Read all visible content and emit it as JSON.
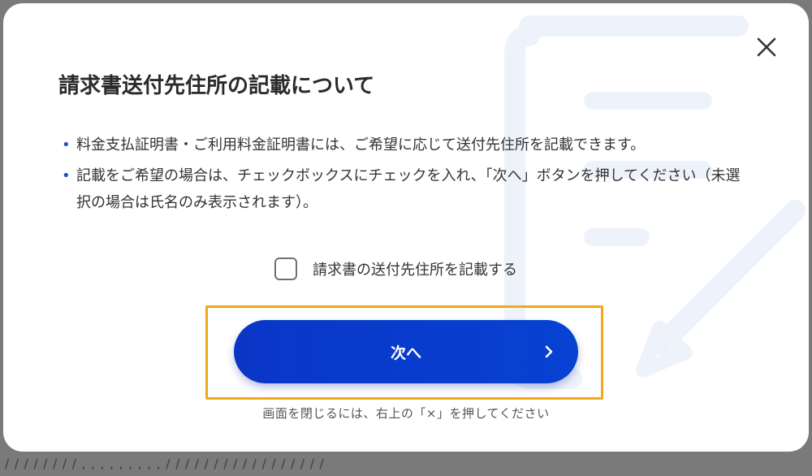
{
  "background": {
    "strip_text": "/ / / / / / / /  , , , , , , , , ,  / / / / / / / /  / / / / / / / / /"
  },
  "modal": {
    "title": "請求書送付先住所の記載について",
    "notes": [
      "料金支払証明書・ご利用料金証明書には、ご希望に応じて送付先住所を記載できます。",
      "記載をご希望の場合は、チェックボックスにチェックを入れ、「次へ」ボタンを押してください（未選択の場合は氏名のみ表示されます）。"
    ],
    "bullet_char": "•",
    "checkbox": {
      "label": "請求書の送付先住所を記載する",
      "checked": false
    },
    "next_button": {
      "label": "次へ",
      "icon": "chevron-right-icon"
    },
    "close_icon": "close-icon",
    "hint": "画面を閉じるには、右上の「×」を押してください"
  },
  "colors": {
    "accent": "#0a36c6",
    "bullet": "#1e4fc4",
    "highlight": "#f2a81b",
    "decoration": "#eef3fb"
  }
}
